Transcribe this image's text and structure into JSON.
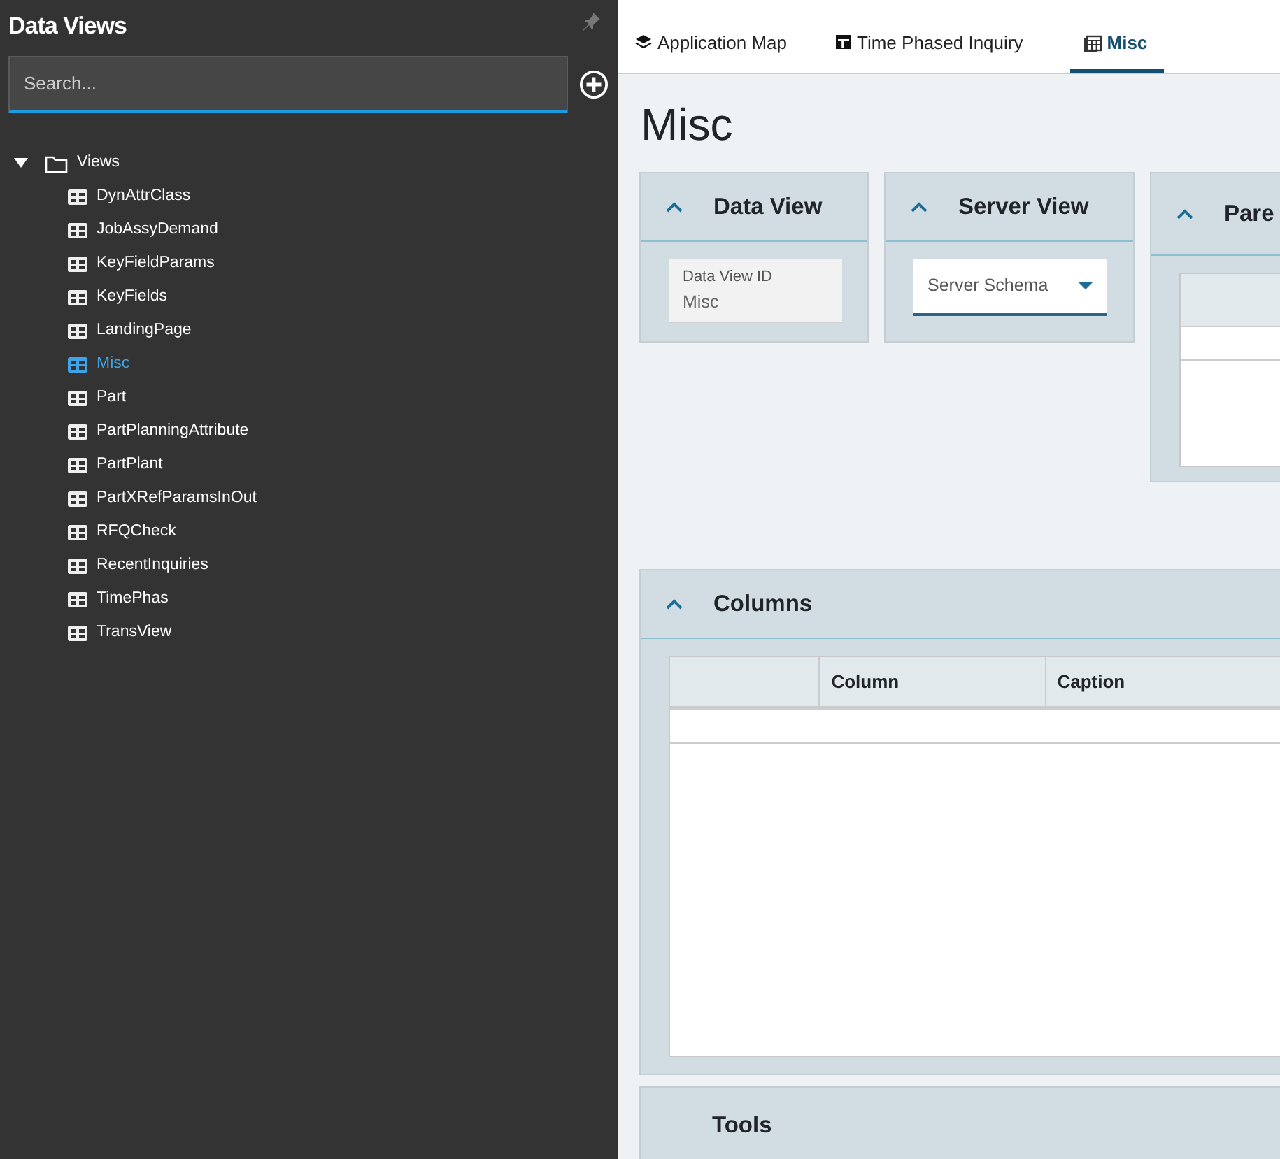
{
  "sidebar": {
    "title": "Data Views",
    "search": {
      "placeholder": "Search..."
    },
    "tree": [
      {
        "label": "Views",
        "expanded": true,
        "children": [
          {
            "label": "DynAttrClass",
            "selected": false
          },
          {
            "label": "JobAssyDemand",
            "selected": false
          },
          {
            "label": "KeyFieldParams",
            "selected": false
          },
          {
            "label": "KeyFields",
            "selected": false
          },
          {
            "label": "LandingPage",
            "selected": false
          },
          {
            "label": "Misc",
            "selected": true
          },
          {
            "label": "Part",
            "selected": false
          },
          {
            "label": "PartPlanningAttribute",
            "selected": false
          },
          {
            "label": "PartPlant",
            "selected": false
          },
          {
            "label": "PartXRefParamsInOut",
            "selected": false
          },
          {
            "label": "RFQCheck",
            "selected": false
          },
          {
            "label": "RecentInquiries",
            "selected": false
          },
          {
            "label": "TimePhas",
            "selected": false
          },
          {
            "label": "TransView",
            "selected": false
          }
        ]
      }
    ]
  },
  "tabs": [
    {
      "label": "Application Map",
      "kind": "layers",
      "selected": false
    },
    {
      "label": "Time Phased Inquiry",
      "kind": "layout",
      "selected": false
    },
    {
      "label": "Misc",
      "kind": "grid",
      "selected": true
    }
  ],
  "page_title": "Misc",
  "panels": [
    {
      "title": "Data View",
      "kind": "field",
      "expanded": true,
      "field": {
        "label": "Data View ID",
        "value": "Misc"
      }
    },
    {
      "title": "Server View",
      "kind": "select",
      "expanded": true,
      "field": {
        "placeholder": "Server Schema"
      }
    },
    {
      "title": "Pare",
      "kind": "table",
      "expanded": true
    }
  ],
  "columns_panel": {
    "title": "Columns",
    "expanded": true,
    "columns": [
      "",
      "Column",
      "Caption"
    ]
  },
  "tools_panel": {
    "title": "Tools"
  }
}
